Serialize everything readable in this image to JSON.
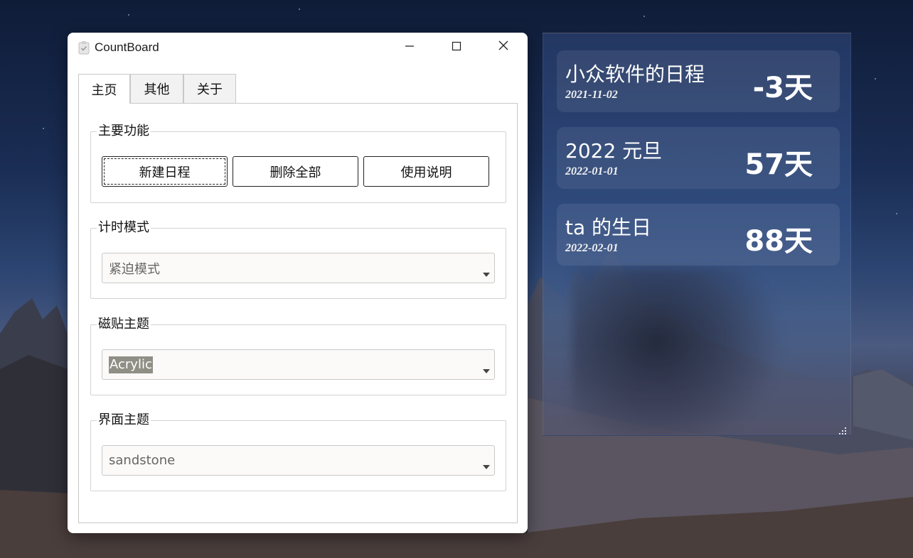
{
  "window": {
    "title": "CountBoard",
    "icon": "clipboard-icon",
    "controls": [
      "minimize-icon",
      "maximize-icon",
      "close-icon"
    ]
  },
  "tabs": [
    {
      "label": "主页",
      "active": true
    },
    {
      "label": "其他",
      "active": false
    },
    {
      "label": "关于",
      "active": false
    }
  ],
  "groups": {
    "main_functions": {
      "legend": "主要功能",
      "buttons": [
        "新建日程",
        "删除全部",
        "使用说明"
      ]
    },
    "timer_mode": {
      "legend": "计时模式",
      "value": "紧迫模式"
    },
    "tile_theme": {
      "legend": "磁贴主题",
      "value": "Acrylic"
    },
    "ui_theme": {
      "legend": "界面主题",
      "value": "sandstone"
    }
  },
  "widget": {
    "events": [
      {
        "name": "小众软件的日程",
        "date": "2021-11-02",
        "days": "-3天"
      },
      {
        "name": "2022 元旦",
        "date": "2022-01-01",
        "days": "57天"
      },
      {
        "name": "ta 的生日",
        "date": "2022-02-01",
        "days": "88天"
      }
    ]
  }
}
